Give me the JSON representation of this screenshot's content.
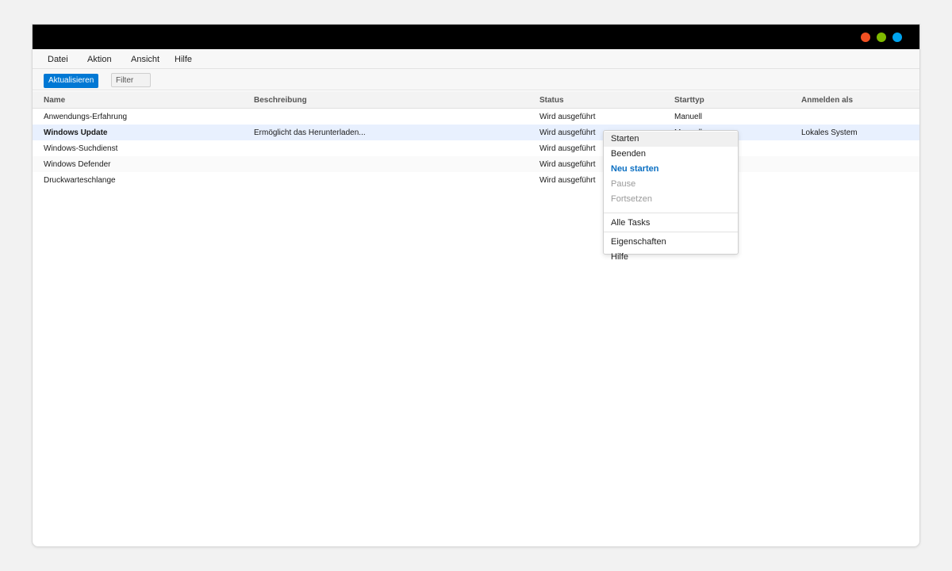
{
  "window": {
    "traffic_lights": [
      "#f25022",
      "#7fba00",
      "#00a4ef"
    ]
  },
  "menubar": {
    "items": [
      "Datei",
      "Aktion",
      "Ansicht",
      "Hilfe"
    ]
  },
  "toolbar": {
    "refresh_label": "Aktualisieren",
    "filter_placeholder": "Filter",
    "accent": "#0078d4"
  },
  "table": {
    "columns": [
      "Name",
      "Beschreibung",
      "Status",
      "Starttyp",
      "Anmelden als"
    ],
    "rows": [
      {
        "name": "Anwendungs-Erfahrung",
        "description": "",
        "status": "Wird ausgeführt",
        "start_type": "Manuell",
        "login": ""
      },
      {
        "name": "Windows Update",
        "description": "Ermöglicht das Herunterladen...",
        "status": "Wird ausgeführt",
        "start_type": "Manuell",
        "login": "Lokales System",
        "selected": true
      },
      {
        "name": "Windows-Suchdienst",
        "description": "",
        "status": "Wird ausgeführt",
        "start_type": "",
        "login": ""
      },
      {
        "name": "Windows Defender",
        "description": "",
        "status": "Wird ausgeführt",
        "start_type": "",
        "login": ""
      },
      {
        "name": "Druckwarteschlange",
        "description": "",
        "status": "Wird ausgeführt",
        "start_type": "",
        "login": ""
      }
    ]
  },
  "context_menu": {
    "items": [
      {
        "label": "Starten",
        "state": "hover"
      },
      {
        "label": "Beenden",
        "state": "normal"
      },
      {
        "label": "Neu starten",
        "state": "accent"
      },
      {
        "label": "Pause",
        "state": "disabled"
      },
      {
        "label": "Fortsetzen",
        "state": "disabled"
      },
      {
        "label": "Alle Tasks",
        "state": "normal"
      },
      {
        "label": "Eigenschaften",
        "state": "normal"
      },
      {
        "label": "Hilfe",
        "state": "normal"
      }
    ]
  }
}
